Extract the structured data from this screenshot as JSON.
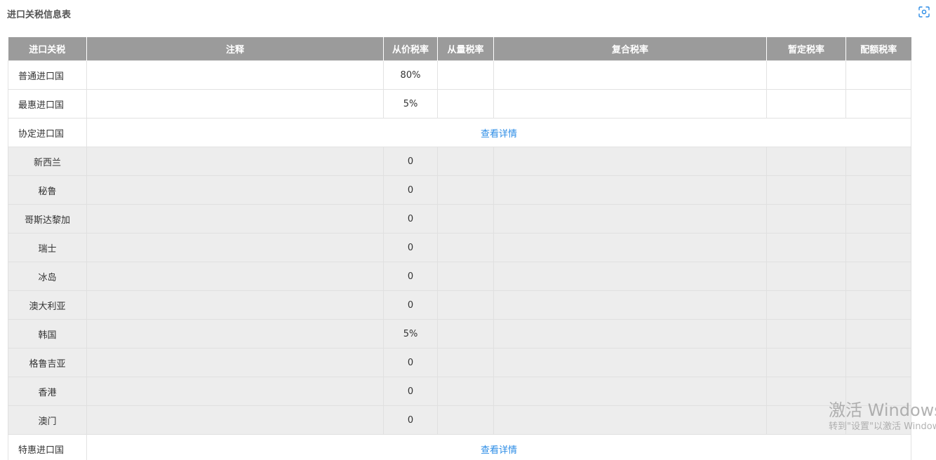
{
  "page": {
    "title": "进口关税信息表"
  },
  "icons": {
    "screenshot": "screenshot-icon",
    "accent_color": "#2b8ce6",
    "header_bg": "#9b9b9b",
    "sub_row_bg": "#ededed"
  },
  "table": {
    "headers": [
      "进口关税",
      "注释",
      "从价税率",
      "从量税率",
      "复合税率",
      "暂定税率",
      "配额税率"
    ],
    "rows": [
      {
        "name": "普通进口国",
        "ad_valorem": "80%"
      },
      {
        "name": "最惠进口国",
        "ad_valorem": "5%"
      },
      {
        "name": "协定进口国",
        "link": "查看详情"
      },
      {
        "name": "新西兰",
        "ad_valorem": "0"
      },
      {
        "name": "秘鲁",
        "ad_valorem": "0"
      },
      {
        "name": "哥斯达黎加",
        "ad_valorem": "0"
      },
      {
        "name": "瑞士",
        "ad_valorem": "0"
      },
      {
        "name": "冰岛",
        "ad_valorem": "0"
      },
      {
        "name": "澳大利亚",
        "ad_valorem": "0"
      },
      {
        "name": "韩国",
        "ad_valorem": "5%"
      },
      {
        "name": "格鲁吉亚",
        "ad_valorem": "0"
      },
      {
        "name": "香港",
        "ad_valorem": "0"
      },
      {
        "name": "澳门",
        "ad_valorem": "0"
      },
      {
        "name": "特惠进口国",
        "link": "查看详情"
      }
    ]
  },
  "watermark": {
    "line1": "激活 Windows",
    "line2": "转到\"设置\"以激活 Windows"
  }
}
